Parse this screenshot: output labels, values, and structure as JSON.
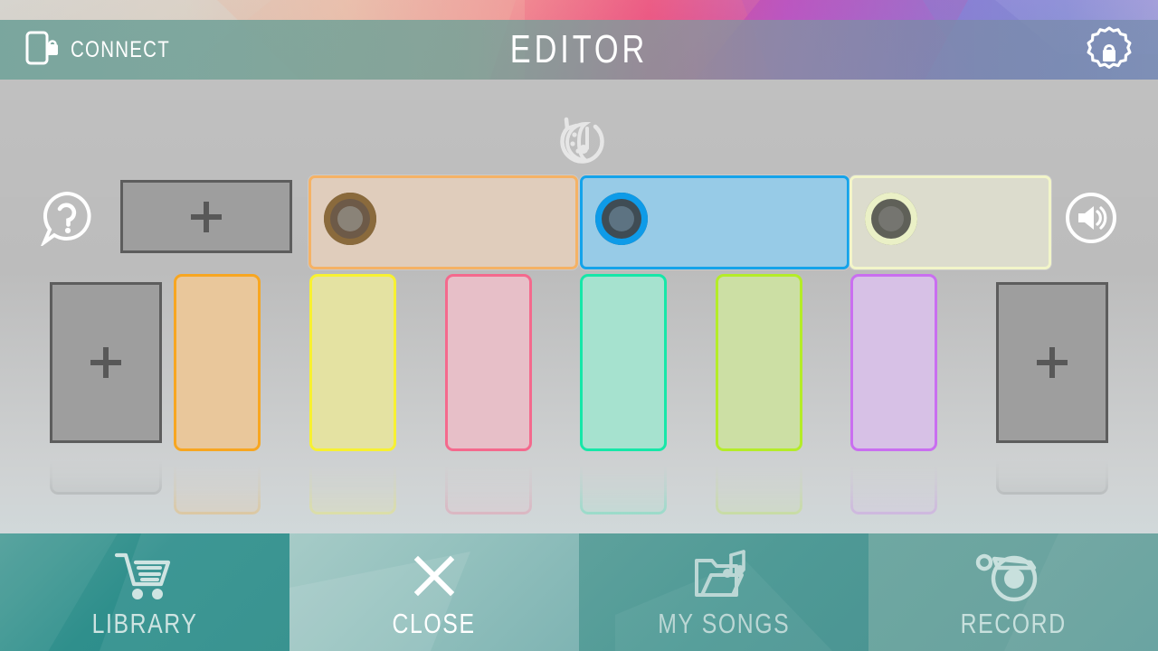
{
  "header": {
    "connect_label": "CONNECT",
    "title": "EDITOR",
    "connect_icon": "phone-lock-icon",
    "settings_icon": "gear-lock-icon"
  },
  "stage": {
    "help_icon": "question-bubble-icon",
    "volume_icon": "speaker-icon",
    "style_icon": "style-shuffle-icon"
  },
  "tracks": {
    "add_label": "+",
    "items": [
      {
        "name": "track-beige",
        "fill": "#e0cdbc",
        "border": "#f5b265",
        "ring_outer": "#6d5a48",
        "ring_mid": "#8a6a3c",
        "ring_inner": "#8a8378"
      },
      {
        "name": "track-blue",
        "fill": "#97cbe7",
        "border": "#14a3ea",
        "ring_outer": "#3f4c54",
        "ring_mid": "#0e9be8",
        "ring_inner": "#5d7382"
      },
      {
        "name": "track-cream",
        "fill": "#dcdccd",
        "border": "#f2f5c9",
        "ring_outer": "#5f6058",
        "ring_mid": "#eaf0c6",
        "ring_inner": "#757570"
      }
    ]
  },
  "loops": {
    "add_label": "+",
    "items": [
      {
        "name": "loop-orange",
        "fill": "#e9c79b",
        "border": "#f7a621"
      },
      {
        "name": "loop-yellow",
        "fill": "#e4e2a2",
        "border": "#f7f131"
      },
      {
        "name": "loop-pink",
        "fill": "#e7bfc8",
        "border": "#f4698d"
      },
      {
        "name": "loop-mint",
        "fill": "#a6e2cf",
        "border": "#16e7a8"
      },
      {
        "name": "loop-lime",
        "fill": "#ccdfa4",
        "border": "#b4ec28"
      },
      {
        "name": "loop-violet",
        "fill": "#d7c1e6",
        "border": "#c96ef0"
      }
    ]
  },
  "bottombar": {
    "buttons": [
      {
        "label": "LIBRARY",
        "icon": "shopping-cart-icon"
      },
      {
        "label": "CLOSE",
        "icon": "close-x-icon"
      },
      {
        "label": "MY SONGS",
        "icon": "folder-music-icon"
      },
      {
        "label": "RECORD",
        "icon": "vinyl-record-icon"
      }
    ]
  },
  "colors": {
    "stage_bg": "#bcbcbc",
    "header_teal": "#6ea098",
    "add_slot_fill": "#9e9e9e",
    "add_slot_border": "#5d5d5d"
  }
}
